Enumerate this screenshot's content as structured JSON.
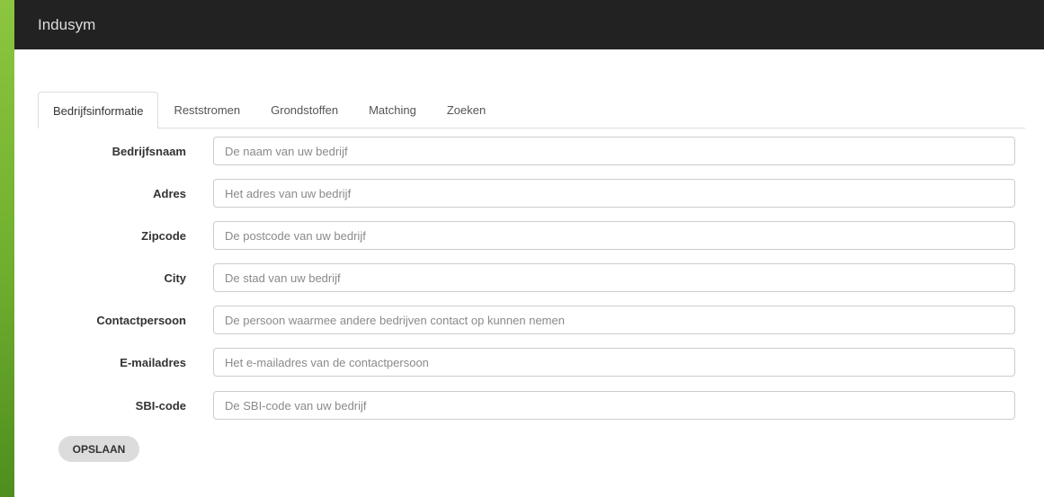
{
  "navbar": {
    "brand": "Indusym"
  },
  "tabs": [
    {
      "label": "Bedrijfsinformatie",
      "active": true
    },
    {
      "label": "Reststromen",
      "active": false
    },
    {
      "label": "Grondstoffen",
      "active": false
    },
    {
      "label": "Matching",
      "active": false
    },
    {
      "label": "Zoeken",
      "active": false
    }
  ],
  "form": {
    "fields": [
      {
        "label": "Bedrijfsnaam",
        "value": "",
        "placeholder": "De naam van uw bedrijf"
      },
      {
        "label": "Adres",
        "value": "",
        "placeholder": "Het adres van uw bedrijf"
      },
      {
        "label": "Zipcode",
        "value": "",
        "placeholder": "De postcode van uw bedrijf"
      },
      {
        "label": "City",
        "value": "",
        "placeholder": "De stad van uw bedrijf"
      },
      {
        "label": "Contactpersoon",
        "value": "",
        "placeholder": "De persoon waarmee andere bedrijven contact op kunnen nemen"
      },
      {
        "label": "E-mailadres",
        "value": "",
        "placeholder": "Het e-mailadres van de contactpersoon"
      },
      {
        "label": "SBI-code",
        "value": "",
        "placeholder": "De SBI-code van uw bedrijf"
      }
    ],
    "save_label": "OPSLAAN"
  },
  "colors": {
    "navbar_bg": "#222222",
    "page_bg_gradient": "#8cc63f",
    "button_bg": "#dcdcdc"
  }
}
